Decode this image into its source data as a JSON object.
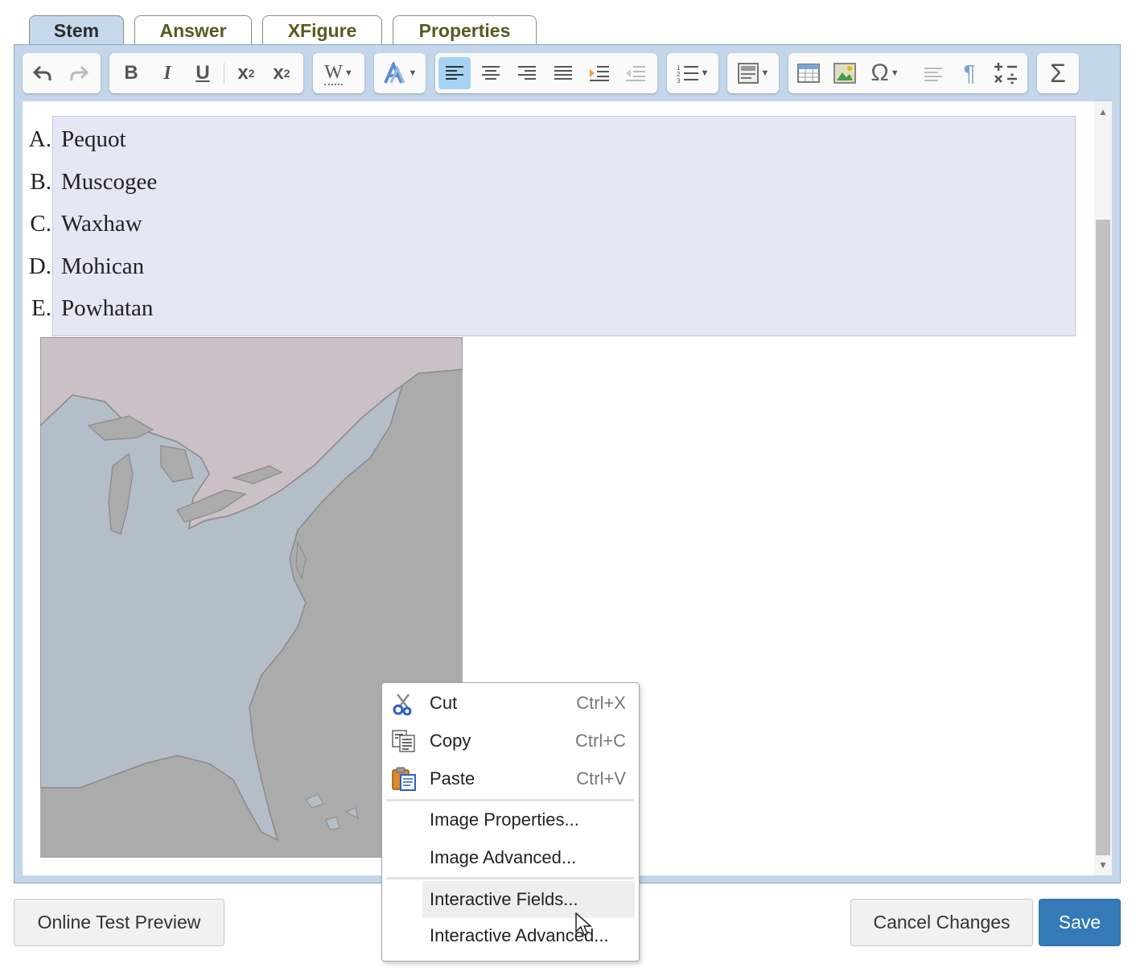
{
  "tabs": [
    {
      "label": "Stem",
      "active": true
    },
    {
      "label": "Answer",
      "active": false
    },
    {
      "label": "XFigure",
      "active": false
    },
    {
      "label": "Properties",
      "active": false
    }
  ],
  "toolbar": {
    "undo_icon": "undo-icon",
    "redo_icon": "redo-icon",
    "bold": "B",
    "italic": "I",
    "underline": "U",
    "subscript": "x",
    "subscript_mark": "2",
    "superscript": "x",
    "superscript_mark": "2",
    "word_style": "W",
    "omega": "Ω",
    "pilcrow": "¶",
    "sigma": "Σ"
  },
  "answers": [
    {
      "letter": "A.",
      "text": "Pequot"
    },
    {
      "letter": "B.",
      "text": "Muscogee"
    },
    {
      "letter": "C.",
      "text": "Waxhaw"
    },
    {
      "letter": "D.",
      "text": "Mohican"
    },
    {
      "letter": "E.",
      "text": "Powhatan"
    }
  ],
  "map": {
    "land_color": "#b3bec8",
    "canada_color": "#cbc0c6",
    "water_color": "#ababab"
  },
  "buttons": {
    "preview": "Online Test Preview",
    "cancel": "Cancel Changes",
    "save": "Save"
  },
  "context_menu": {
    "cut": {
      "label": "Cut",
      "shortcut": "Ctrl+X",
      "icon": "scissors-icon"
    },
    "copy": {
      "label": "Copy",
      "shortcut": "Ctrl+C",
      "icon": "copy-icon"
    },
    "paste": {
      "label": "Paste",
      "shortcut": "Ctrl+V",
      "icon": "paste-icon"
    },
    "image_properties": "Image Properties...",
    "image_advanced": "Image Advanced...",
    "interactive_fields": "Interactive Fields...",
    "interactive_advanced": "Interactive Advanced..."
  },
  "colors": {
    "accent": "#337ab7",
    "tab_text": "#58591f",
    "frame": "#c3d6ea"
  }
}
